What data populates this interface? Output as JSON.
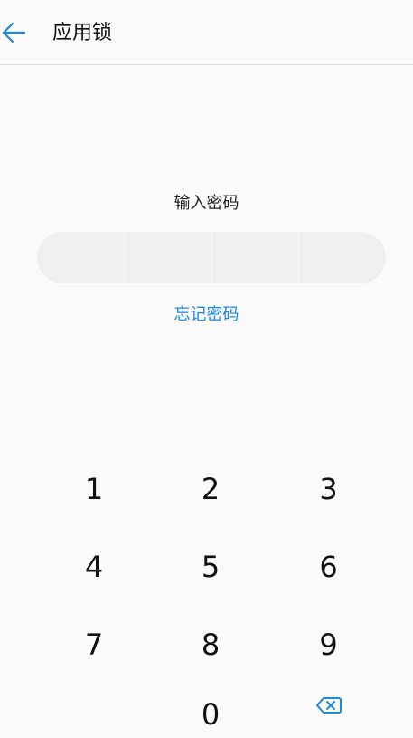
{
  "app_bar": {
    "back_icon": "arrow-left-icon",
    "title": "应用锁",
    "accent": "#1e88e5"
  },
  "pin": {
    "prompt": "输入密码",
    "length": 4,
    "entered": 0,
    "forgot_label": "忘记密码"
  },
  "keypad": {
    "k1": "1",
    "k2": "2",
    "k3": "3",
    "k4": "4",
    "k5": "5",
    "k6": "6",
    "k7": "7",
    "k8": "8",
    "k9": "9",
    "k0": "0",
    "backspace_icon": "backspace-icon"
  }
}
